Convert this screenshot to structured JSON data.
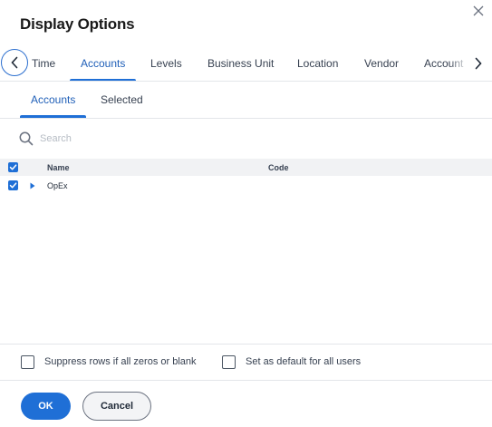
{
  "dialog": {
    "title": "Display Options"
  },
  "tabs": [
    {
      "label": "Time"
    },
    {
      "label": "Accounts"
    },
    {
      "label": "Levels"
    },
    {
      "label": "Business Unit"
    },
    {
      "label": "Location"
    },
    {
      "label": "Vendor"
    },
    {
      "label": "Account"
    }
  ],
  "active_tab": "Accounts",
  "subtabs": [
    {
      "label": "Accounts"
    },
    {
      "label": "Selected"
    }
  ],
  "active_subtab": "Accounts",
  "search": {
    "placeholder": "Search",
    "value": ""
  },
  "grid": {
    "columns": {
      "name": "Name",
      "code": "Code"
    },
    "header_checked": true,
    "rows": [
      {
        "name": "OpEx",
        "code": "",
        "checked": true,
        "expandable": true
      }
    ]
  },
  "options": {
    "suppress_label": "Suppress rows if all zeros or blank",
    "suppress_checked": false,
    "default_label": "Set as default for all users",
    "default_checked": false
  },
  "buttons": {
    "ok": "OK",
    "cancel": "Cancel"
  },
  "colors": {
    "accent": "#1f6fd6",
    "active_tab_text": "#1f5fb8"
  }
}
